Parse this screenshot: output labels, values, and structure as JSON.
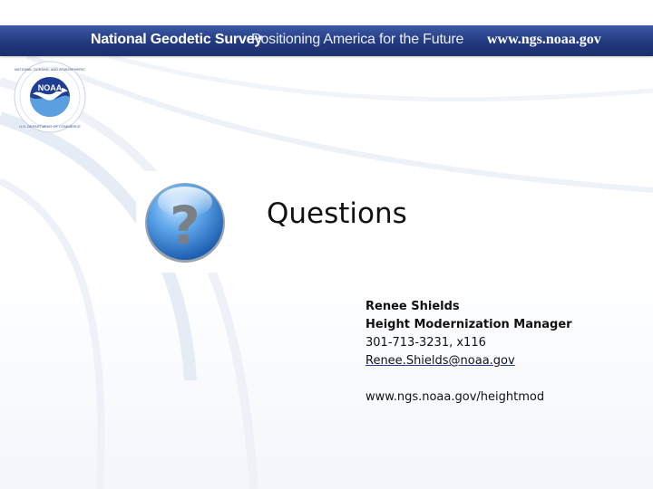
{
  "banner": {
    "organization": "National Geodetic Survey",
    "tagline": "Positioning America for the Future",
    "url": "www.ngs.noaa.gov"
  },
  "logo": {
    "name": "NOAA",
    "icon": "noaa-seal-icon"
  },
  "slide": {
    "title": "Questions",
    "icon": "question-mark-icon"
  },
  "contact": {
    "name": "Renee Shields",
    "role": "Height Modernization Manager",
    "phone": "301-713-3231, x116",
    "email": "Renee.Shields@noaa.gov",
    "website": "www.ngs.noaa.gov/heightmod"
  },
  "colors": {
    "banner": "#22397e",
    "accent": "#2f7fd0",
    "text": "#111111"
  }
}
